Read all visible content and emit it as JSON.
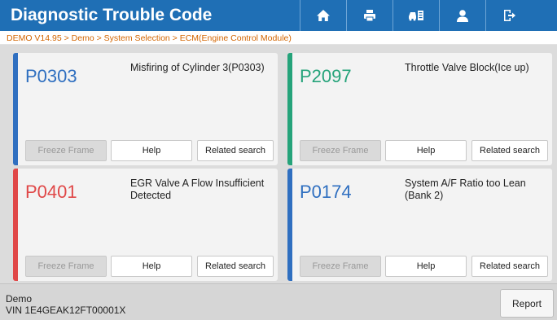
{
  "header": {
    "title": "Diagnostic Trouble Code",
    "background": "#1f6fb5",
    "buttons": [
      {
        "icon": "home-icon"
      },
      {
        "icon": "print-icon"
      },
      {
        "icon": "vehicle-id-icon"
      },
      {
        "icon": "user-icon"
      },
      {
        "icon": "exit-icon"
      }
    ]
  },
  "breadcrumb": "DEMO V14.95 > Demo > System Selection > ECM(Engine Control Module)",
  "dtcs": [
    {
      "code": "P0303",
      "description": "Misfiring of Cylinder 3(P0303)",
      "color": "#2f6fc0",
      "freeze_frame": "Freeze Frame",
      "help": "Help",
      "related": "Related search"
    },
    {
      "code": "P2097",
      "description": "Throttle Valve Block(Ice up)",
      "color": "#25a37a",
      "freeze_frame": "Freeze Frame",
      "help": "Help",
      "related": "Related search"
    },
    {
      "code": "P0401",
      "description": "EGR Valve A Flow Insufficient Detected",
      "color": "#e04848",
      "freeze_frame": "Freeze Frame",
      "help": "Help",
      "related": "Related search"
    },
    {
      "code": "P0174",
      "description": "System A/F Ratio too Lean (Bank 2)",
      "color": "#2f6fc0",
      "freeze_frame": "Freeze Frame",
      "help": "Help",
      "related": "Related search"
    }
  ],
  "footer": {
    "vehicle": "Demo",
    "vin": "VIN 1E4GEAK12FT00001X",
    "report_label": "Report"
  }
}
